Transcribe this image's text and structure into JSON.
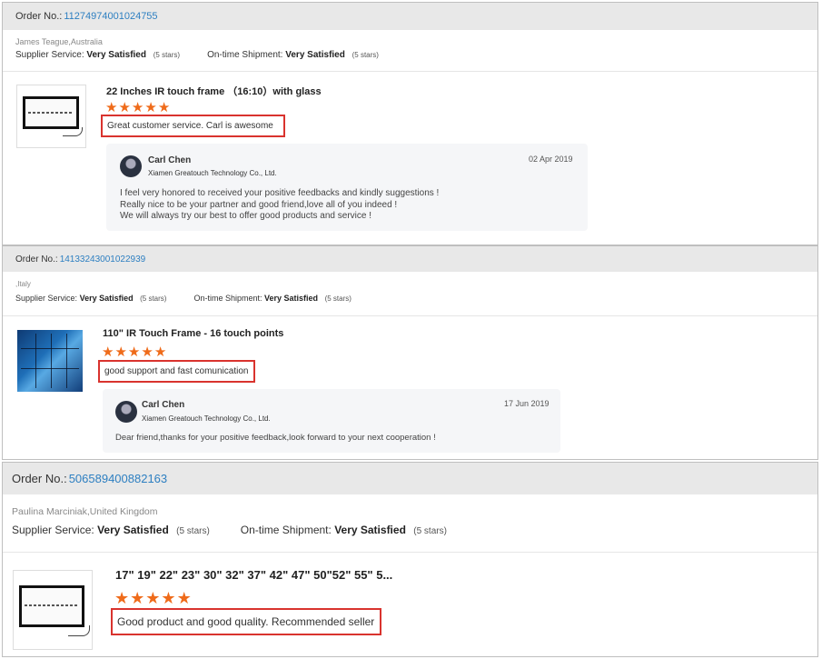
{
  "labels": {
    "order_no": "Order No.:",
    "supplier_service": "Supplier Service:",
    "ontime_shipment": "On-time Shipment:"
  },
  "orders": [
    {
      "order_number": "11274974001024755",
      "buyer": "James Teague,Australia",
      "supplier_rating": "Very Satisfied",
      "supplier_stars": "(5 stars)",
      "shipment_rating": "Very Satisfied",
      "shipment_stars": "(5 stars)",
      "product_title": "22 Inches IR touch frame （16:10）with glass",
      "stars": 5,
      "review": "Great customer service. Carl is awesome",
      "reply": {
        "name": "Carl Chen",
        "company": "Xiamen Greatouch Technology Co., Ltd.",
        "date": "02 Apr 2019",
        "lines": [
          "I feel very honored to received your positive feedbacks and kindly suggestions !",
          "Really nice to be your partner and good friend,love all of you indeed !",
          "We will always try our best to offer good products and service !"
        ]
      }
    },
    {
      "order_number": "14133243001022939",
      "buyer": ",Italy",
      "supplier_rating": "Very Satisfied",
      "supplier_stars": "(5 stars)",
      "shipment_rating": "Very Satisfied",
      "shipment_stars": "(5 stars)",
      "product_title": "110\" IR Touch Frame - 16 touch points",
      "stars": 5,
      "review": "good support and fast comunication",
      "reply": {
        "name": "Carl Chen",
        "company": "Xiamen Greatouch Technology Co., Ltd.",
        "date": "17 Jun 2019",
        "lines": [
          "Dear friend,thanks for your positive feedback,look forward to your next cooperation !"
        ]
      }
    },
    {
      "order_number": "506589400882163",
      "buyer": "Paulina Marciniak,United Kingdom",
      "supplier_rating": "Very Satisfied",
      "supplier_stars": "(5 stars)",
      "shipment_rating": "Very Satisfied",
      "shipment_stars": "(5 stars)",
      "product_title": "17\" 19\" 22\" 23\" 30\" 32\" 37\" 42\" 47\" 50\"52\" 55\" 5...",
      "stars": 5,
      "review": "Good product and good quality. Recommended seller"
    }
  ],
  "colors": {
    "accent_link": "#2d7fc1",
    "star": "#ef6b1a",
    "highlight_border": "#d9332e"
  },
  "icons": {
    "star": "star-icon",
    "avatar": "supplier-avatar"
  }
}
